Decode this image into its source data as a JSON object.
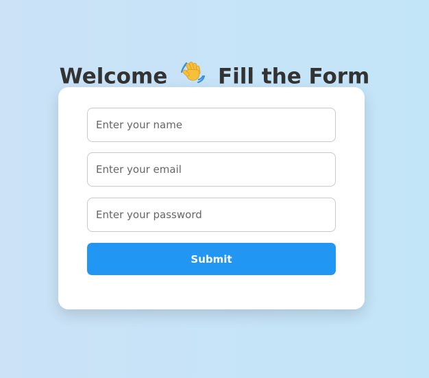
{
  "header": {
    "title_prefix": "Welcome",
    "title_suffix": "Fill the Form",
    "icon": "waving-hand-icon"
  },
  "form": {
    "name_placeholder": "Enter your name",
    "name_value": "",
    "email_placeholder": "Enter your email",
    "email_value": "",
    "password_placeholder": "Enter your password",
    "password_value": "",
    "submit_label": "Submit"
  },
  "colors": {
    "accent": "#2196f3",
    "title_text": "#333333",
    "background_start": "#cbe2f7",
    "background_end": "#c3e5f8"
  }
}
